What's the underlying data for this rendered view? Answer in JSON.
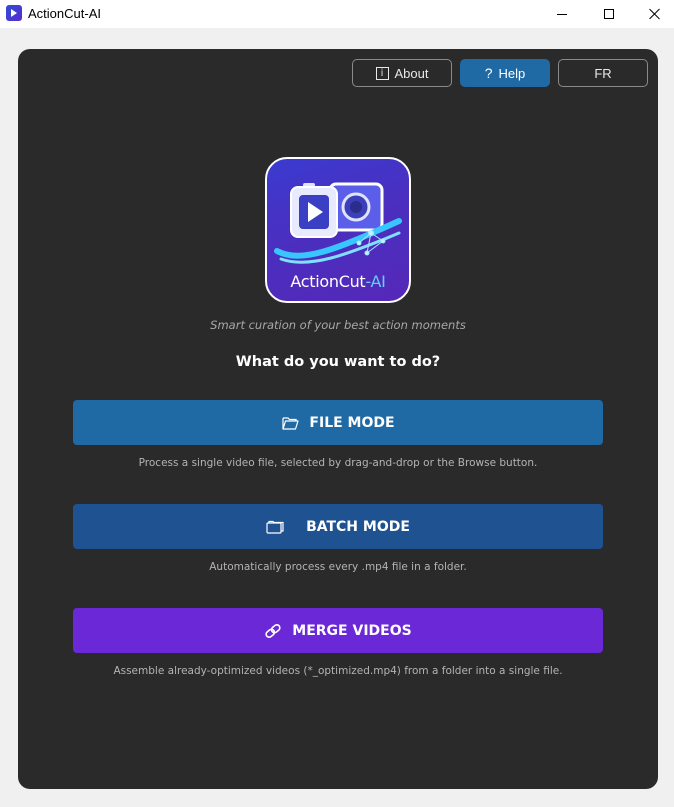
{
  "window": {
    "title": "ActionCut-AI"
  },
  "header": {
    "about_label": "About",
    "help_label": "Help",
    "language_label": "FR"
  },
  "logo": {
    "text_main": "ActionCut",
    "text_accent": "-AI"
  },
  "main": {
    "tagline": "Smart curation of your best action moments",
    "question": "What do you want to do?",
    "modes": [
      {
        "label": "FILE MODE",
        "icon": "folder-open-icon",
        "description": "Process a single video file, selected by drag-and-drop or the Browse button.",
        "color": "#1f6aa5"
      },
      {
        "label": "BATCH MODE",
        "icon": "folder-stack-icon",
        "description": "Automatically process every .mp4 file in a folder.",
        "color": "#1f5290"
      },
      {
        "label": "MERGE VIDEOS",
        "icon": "link-icon",
        "description": "Assemble already-optimized videos (*_optimized.mp4) from a folder into a single file.",
        "color": "#6b28d6"
      }
    ]
  },
  "colors": {
    "panel_bg": "#2a2a2a",
    "accent_blue": "#1f6aa5",
    "accent_purple": "#6b28d6"
  }
}
